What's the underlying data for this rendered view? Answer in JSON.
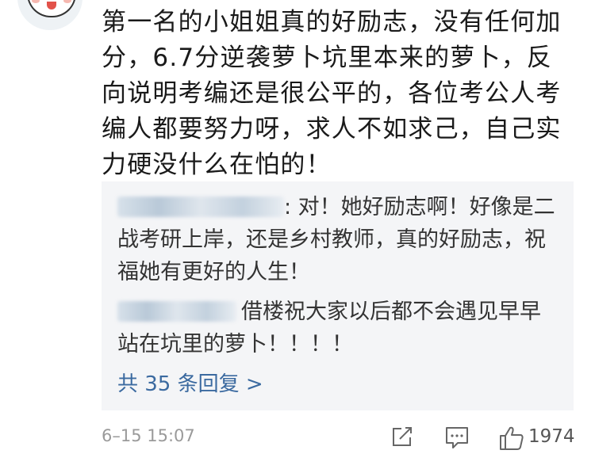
{
  "comment": {
    "text": "第一名的小姐姐真的好励志，没有任何加分，6.7分逆袭萝卜坑里本来的萝卜，反向说明考编还是很公平的，各位考公人考编人都要努力呀，求人不如求己，自己实力硬没什么在怕的！"
  },
  "replies": [
    {
      "text": ": 对！她好励志啊！好像是二战考研上岸，还是乡村教师，真的好励志，祝福她有更好的人生！"
    },
    {
      "text": "借楼祝大家以后都不会遇见早早站在坑里的萝卜！！！！"
    }
  ],
  "more_replies": "共 35 条回复 >",
  "footer": {
    "timestamp": "6–15 15:07",
    "like_count": "1974"
  },
  "colors": {
    "link": "#3b6aa0",
    "reply_bg": "#f4f5f7"
  },
  "icons": {
    "share": "share-icon",
    "comment": "comment-icon",
    "like": "thumbs-up-icon"
  }
}
